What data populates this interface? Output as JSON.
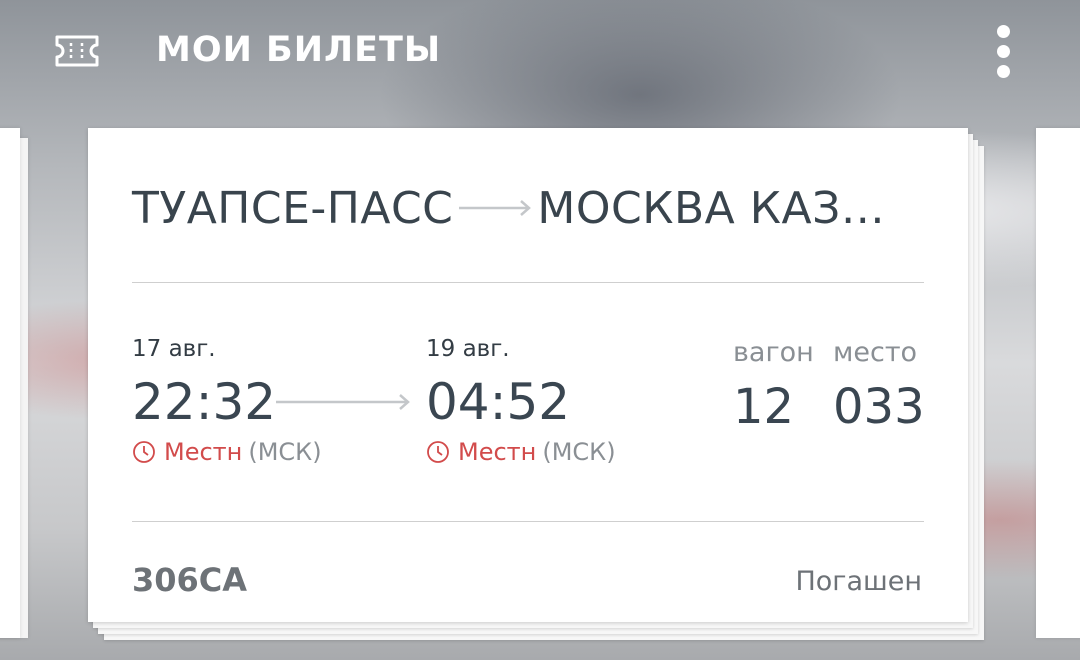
{
  "header": {
    "title": "МОИ БИЛЕТЫ",
    "left_icon": "ticket-icon",
    "right_icon": "more-vert-icon"
  },
  "ticket": {
    "from": "ТУАПСЕ-ПАСС",
    "to": "МОСКВА КАЗ…",
    "departure": {
      "date": "17 авг.",
      "time": "22:32",
      "tz_local": "Местн",
      "tz_msk": "(МСК)"
    },
    "arrival": {
      "date": "19 авг.",
      "time": "04:52",
      "tz_local": "Местн",
      "tz_msk": "(МСК)"
    },
    "car_label": "вагон",
    "car_value": "12",
    "seat_label": "место",
    "seat_value": "033",
    "train_number": "306СА",
    "status": "Погашен"
  },
  "colors": {
    "accent_red": "#d24b4b",
    "text_dark": "#3a4651",
    "text_gray": "#8a8f94"
  }
}
